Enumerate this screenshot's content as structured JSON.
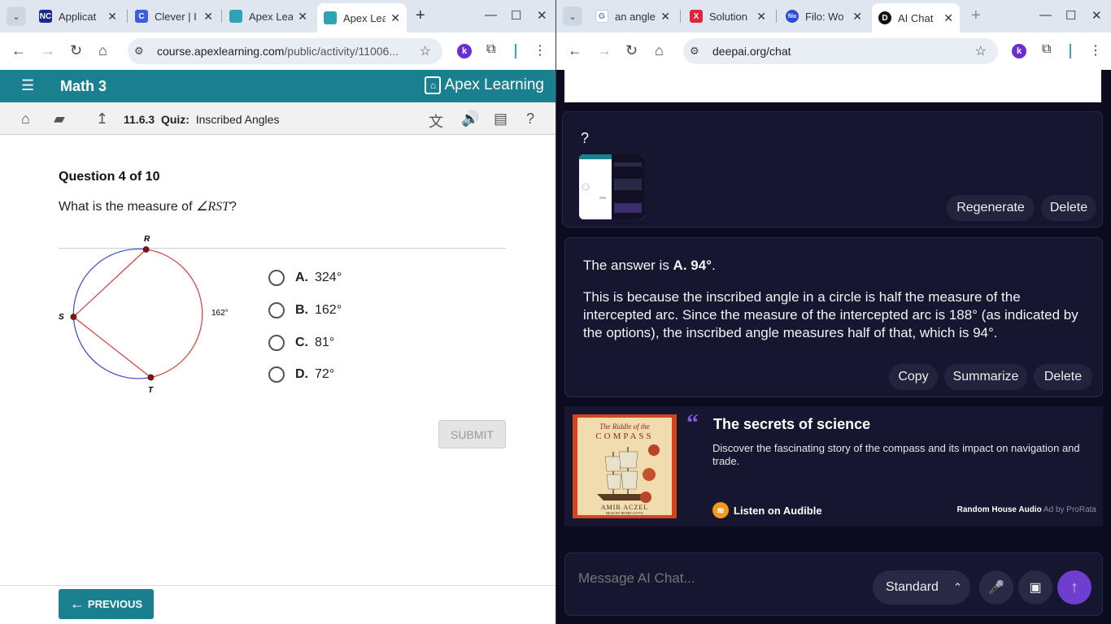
{
  "left_browser": {
    "tabs": [
      {
        "title": "Applicat",
        "favicon": "NC"
      },
      {
        "title": "Clever | I",
        "favicon": "C"
      },
      {
        "title": "Apex Lea",
        "favicon": "A"
      },
      {
        "title": "Apex Lea",
        "favicon": "A"
      }
    ],
    "url_host": "course.apexlearning.com",
    "url_path": "/public/activity/11006...",
    "profile_initial": "k"
  },
  "apex": {
    "course_title": "Math 3",
    "logo_text": "Apex Learning",
    "breadcrumb_code": "11.6.3",
    "breadcrumb_type": "Quiz:",
    "breadcrumb_title": "Inscribed Angles",
    "question_counter": "Question 4 of 10",
    "question_prefix": "What is the measure of",
    "question_angle": "∠RST",
    "question_suffix": "?",
    "figure": {
      "label_r": "R",
      "label_s": "S",
      "label_t": "T",
      "arc_label": "162°"
    },
    "options": [
      {
        "letter": "A.",
        "value": "324°"
      },
      {
        "letter": "B.",
        "value": "162°"
      },
      {
        "letter": "C.",
        "value": "81°"
      },
      {
        "letter": "D.",
        "value": "72°"
      }
    ],
    "submit_label": "SUBMIT",
    "previous_label": "PREVIOUS"
  },
  "right_browser": {
    "tabs": [
      {
        "title": "an angle",
        "favicon": "G"
      },
      {
        "title": "Solution",
        "favicon": "X"
      },
      {
        "title": "Filo: Wo",
        "favicon": "filo"
      },
      {
        "title": "AI Chat",
        "favicon": "D"
      }
    ],
    "url": "deepai.org/chat",
    "profile_initial": "k"
  },
  "deepai": {
    "user_message": "?",
    "regenerate_label": "Regenerate",
    "delete_label": "Delete",
    "answer_intro": "The answer is ",
    "answer_bold": "A. 94°",
    "answer_end": ".",
    "answer_body": "This is because the inscribed angle in a circle is half the measure of the intercepted arc. Since the measure of the intercepted arc is 188° (as indicated by the options), the inscribed angle measures half of that, which is 94°.",
    "copy_label": "Copy",
    "summarize_label": "Summarize",
    "delete2_label": "Delete",
    "ad": {
      "title": "The secrets of science",
      "description": "Discover the fascinating story of the compass and its impact on navigation and trade.",
      "cta": "Listen on Audible",
      "publisher": "Random House Audio",
      "ad_by": "Ad by ProRata",
      "book_title_1": "The Riddle of the",
      "book_title_2": "COMPASS",
      "book_author": "AMIR ACZEL",
      "book_reader": "READ BY HENRY LEYVA"
    },
    "chat_placeholder": "Message AI Chat...",
    "mode_label": "Standard"
  },
  "colors": {
    "apex_teal": "#1a7f8e",
    "deepai_bg": "#0c0b1f",
    "deepai_card": "#171631",
    "send_purple": "#6e3fcf",
    "arc_red": "#e03a3a",
    "arc_blue": "#3b47d6"
  }
}
